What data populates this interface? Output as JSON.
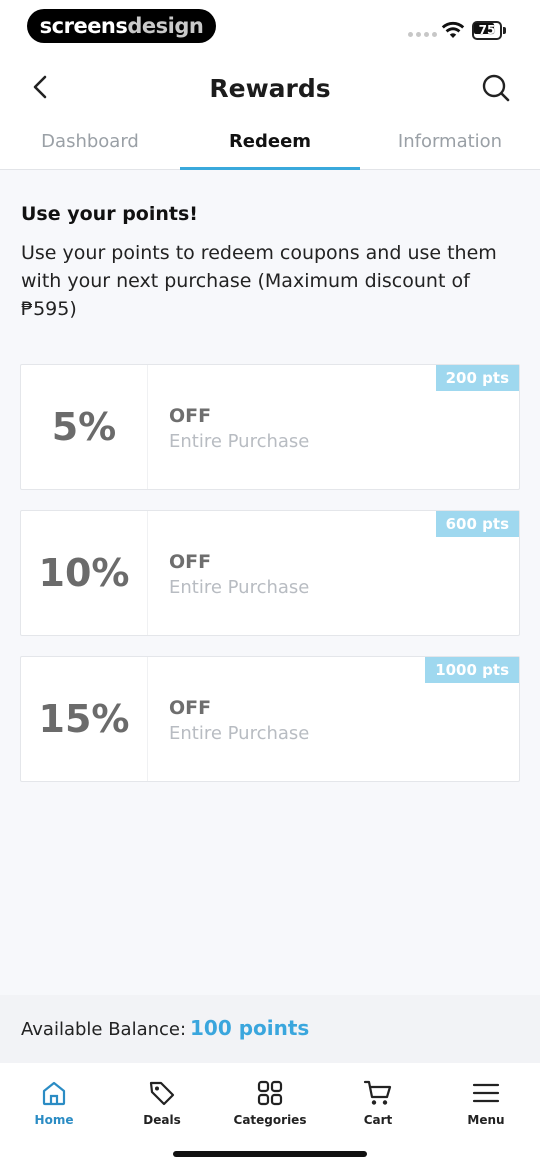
{
  "status_bar": {
    "watermark_a": "screens",
    "watermark_b": "design",
    "battery": "75"
  },
  "header": {
    "title": "Rewards"
  },
  "tabs": [
    {
      "label": "Dashboard"
    },
    {
      "label": "Redeem"
    },
    {
      "label": "Information"
    }
  ],
  "intro": {
    "heading": "Use your points!",
    "text": "Use your points to redeem coupons and use them with your next purchase (Maximum discount of ₱595)"
  },
  "coupons": [
    {
      "percent": "5%",
      "off": "OFF",
      "scope": "Entire Purchase",
      "points": "200 pts"
    },
    {
      "percent": "10%",
      "off": "OFF",
      "scope": "Entire Purchase",
      "points": "600 pts"
    },
    {
      "percent": "15%",
      "off": "OFF",
      "scope": "Entire Purchase",
      "points": "1000 pts"
    }
  ],
  "balance": {
    "label": "Available Balance:",
    "value": "100 points"
  },
  "bottom_nav": [
    {
      "label": "Home",
      "icon": "home-icon"
    },
    {
      "label": "Deals",
      "icon": "tag-icon"
    },
    {
      "label": "Categories",
      "icon": "grid-icon"
    },
    {
      "label": "Cart",
      "icon": "cart-icon"
    },
    {
      "label": "Menu",
      "icon": "menu-icon"
    }
  ],
  "colors": {
    "accent": "#39a9dc",
    "badge": "#9fd8ef",
    "balance_value": "#3aa6dd"
  }
}
